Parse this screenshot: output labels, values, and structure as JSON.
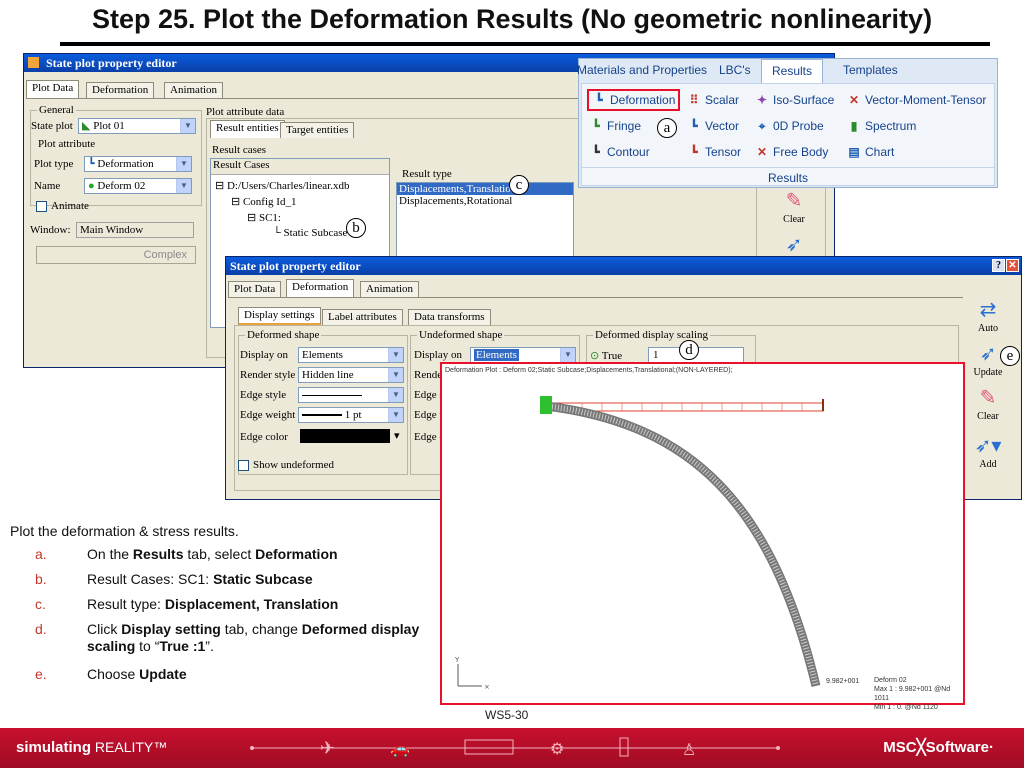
{
  "slide": {
    "title": "Step 25. Plot the Deformation Results (No geometric nonlinearity)",
    "page": "WS5-30"
  },
  "win1": {
    "title": "State plot property editor",
    "tabs": [
      "Plot Data",
      "Deformation",
      "Animation"
    ],
    "general_label": "General",
    "state_plot_label": "State plot",
    "state_plot_value": "Plot 01",
    "plot_attribute_label": "Plot attribute",
    "plot_type_label": "Plot type",
    "plot_type_value": "Deformation",
    "name_label": "Name",
    "name_value": "Deform 02",
    "animate_label": "Animate",
    "window_label": "Window:",
    "window_value": "Main Window",
    "complex_label": "Complex",
    "plot_attr_data_label": "Plot attribute data",
    "subtabs": [
      "Result entities",
      "Target entities"
    ],
    "result_cases_label": "Result cases",
    "result_cases_header": "Result Cases",
    "tree": [
      "D:/Users/Charles/linear.xdb",
      "Config Id_1",
      "SC1:",
      "Static Subcase"
    ],
    "result_type_label": "Result type",
    "result_types": [
      "Displacements,Translational",
      "Displacements,Rotational"
    ]
  },
  "ribbon": {
    "tabs": [
      "Materials and Properties",
      "LBC's",
      "Results",
      "Templates"
    ],
    "items": [
      {
        "label": "Deformation",
        "icon": "deformation-icon"
      },
      {
        "label": "Scalar",
        "icon": "scalar-icon"
      },
      {
        "label": "Iso-Surface",
        "icon": "iso-surface-icon"
      },
      {
        "label": "Vector-Moment-Tensor",
        "icon": "vector-moment-tensor-icon"
      },
      {
        "label": "Fringe",
        "icon": "fringe-icon"
      },
      {
        "label": "Vector",
        "icon": "vector-icon"
      },
      {
        "label": "0D Probe",
        "icon": "probe-icon"
      },
      {
        "label": "Spectrum",
        "icon": "spectrum-icon"
      },
      {
        "label": "Contour",
        "icon": "contour-icon"
      },
      {
        "label": "Tensor",
        "icon": "tensor-icon"
      },
      {
        "label": "Free Body",
        "icon": "free-body-icon"
      },
      {
        "label": "Chart",
        "icon": "chart-icon"
      }
    ],
    "group_label": "Results"
  },
  "win2": {
    "title": "State plot property editor",
    "tabs": [
      "Plot Data",
      "Deformation",
      "Animation"
    ],
    "subtabs": [
      "Display settings",
      "Label attributes",
      "Data transforms"
    ],
    "deformed_shape_label": "Deformed shape",
    "display_on_label": "Display on",
    "display_on_value": "Elements",
    "render_style_label": "Render style",
    "render_style_value": "Hidden line",
    "edge_style_label": "Edge style",
    "edge_weight_label": "Edge weight",
    "edge_weight_value": "1 pt",
    "edge_color_label": "Edge color",
    "show_undeformed_label": "Show undeformed",
    "undeformed_shape_label": "Undeformed shape",
    "undeformed_display_on_value": "Elements",
    "undeformed_render_label": "Rende",
    "undeformed_edge_s_label": "Edge s",
    "undeformed_edge_w_label": "Edge w",
    "undeformed_edge_c_label": "Edge c",
    "scaling_label": "Deformed display scaling",
    "true_label": "True",
    "scale_value": "1"
  },
  "tools": {
    "top": [
      "Clear"
    ],
    "side": [
      "Auto",
      "Update",
      "Clear",
      "Add"
    ]
  },
  "plot": {
    "caption": "Deformation Plot : Deform 02;Static Subcase;Displacements,Translational;(NON-LAYERED);",
    "tip_value": "9.982+001",
    "legend_title": "Deform 02",
    "legend_max": "Max 1 : 9.982+001 @Nd 1011",
    "legend_min": "Min 1 : 0. @Nd 1120"
  },
  "callouts": [
    "a",
    "b",
    "c",
    "d",
    "e"
  ],
  "instructions": {
    "intro": "Plot the deformation & stress results.",
    "steps": [
      {
        "marker": "a.",
        "parts": [
          "On the ",
          "Results",
          " tab, select ",
          "Deformation"
        ]
      },
      {
        "marker": "b.",
        "parts": [
          "Result Cases: SC1: ",
          "Static Subcase"
        ]
      },
      {
        "marker": "c.",
        "parts": [
          "Result type: ",
          "Displacement, Translation"
        ]
      },
      {
        "marker": "d.",
        "parts": [
          "Click ",
          "Display setting",
          " tab, change ",
          "Deformed display scaling",
          " to “",
          "True :1",
          "”."
        ]
      },
      {
        "marker": "e.",
        "parts": [
          "Choose ",
          "Update"
        ]
      }
    ]
  },
  "footer": {
    "left_bold": "simulating",
    "left_rest": "REALITY™",
    "right": "MSC╳Software·"
  },
  "colors": {
    "accent_red": "#e8102a",
    "footer_red": "#b80f2a",
    "xp_blue": "#0a46c8",
    "ribbon_text": "#15428b"
  }
}
